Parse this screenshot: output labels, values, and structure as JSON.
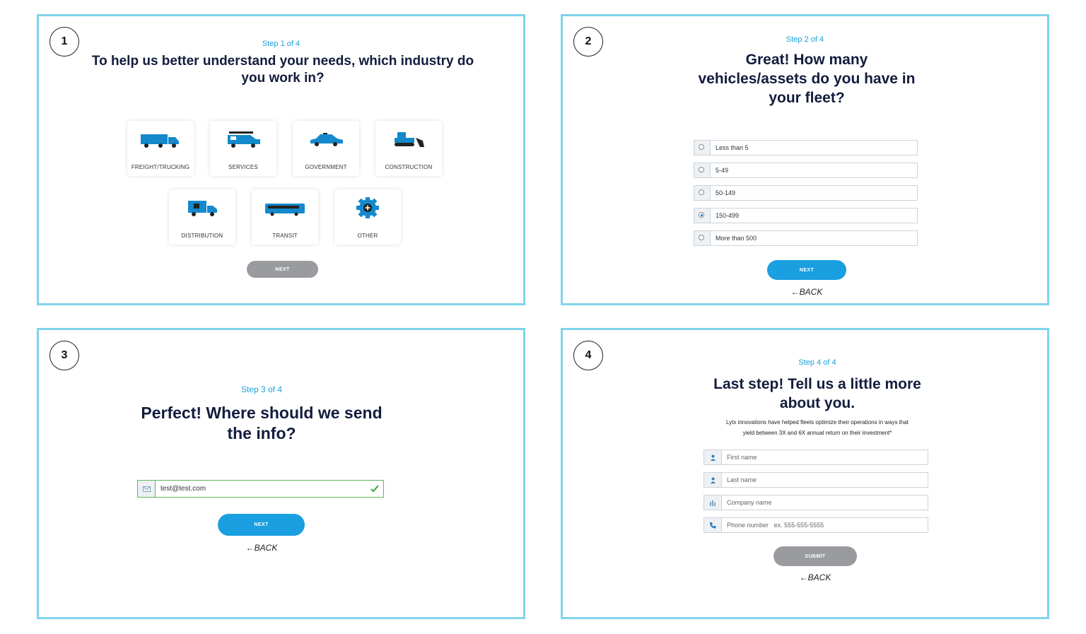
{
  "panels": {
    "p1": {
      "number": "1",
      "step": "Step 1 of 4",
      "title": "To help us better understand your needs, which industry do you work in?",
      "industries": [
        "FREIGHT/TRUCKING",
        "SERVICES",
        "GOVERNMENT",
        "CONSTRUCTION",
        "DISTRIBUTION",
        "TRANSIT",
        "OTHER"
      ],
      "next_label": "NEXT"
    },
    "p2": {
      "number": "2",
      "step": "Step 2 of 4",
      "title": "Great! How many vehicles/assets do you have in your fleet?",
      "options": [
        "Less than 5",
        "5-49",
        "50-149",
        "150-499",
        "More than 500"
      ],
      "selected_option": "150-499",
      "next_label": "NEXT",
      "back_label": "BACK"
    },
    "p3": {
      "number": "3",
      "step": "Step 3 of 4",
      "title": "Perfect! Where should we send the info?",
      "email_value": "test@test.com",
      "next_label": "NEXT",
      "back_label": "BACK"
    },
    "p4": {
      "number": "4",
      "step": "Step 4 of 4",
      "title": "Last step! Tell us a little more about you.",
      "description_line1": "Lytx innovations have helped fleets optimize their operations in ways that",
      "description_line2": "yield between 3X and 6X annual return on their investment*",
      "fields": {
        "first_name": "First name",
        "last_name": "Last name",
        "company": "Company name",
        "phone": "Phone number",
        "phone_example": "ex. 555-555-5555"
      },
      "submit_label": "SUBMIT",
      "back_label": "BACK"
    }
  },
  "colors": {
    "frame": "#7fd3ea",
    "accent_blue": "#1a9fe0",
    "icon_blue": "#1489cc",
    "dark_navy": "#131c3d",
    "disabled_gray": "#999b9e",
    "check_green": "#3aa336"
  },
  "icons": [
    "truck-icon",
    "van-icon",
    "car-icon",
    "bulldozer-icon",
    "box-truck-icon",
    "bus-icon",
    "gear-plus-icon",
    "envelope-icon",
    "check-icon",
    "person-icon",
    "building-icon",
    "phone-icon",
    "arrow-left-icon"
  ]
}
